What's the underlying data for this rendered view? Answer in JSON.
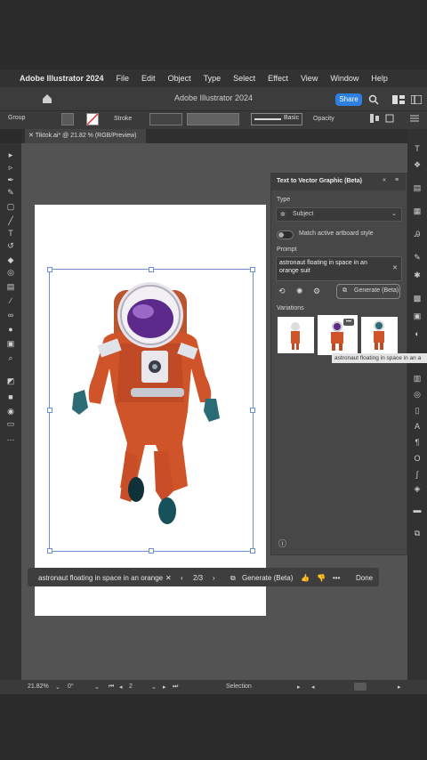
{
  "menubar": {
    "app_name": "Adobe Illustrator 2024",
    "items": [
      "File",
      "Edit",
      "Object",
      "Type",
      "Select",
      "Effect",
      "View",
      "Window",
      "Help"
    ]
  },
  "titlebar": {
    "title": "Adobe Illustrator 2024",
    "share_label": "Share"
  },
  "controlbar": {
    "selection_label": "Group",
    "stroke_label": "Stroke",
    "brush_label": "Basic",
    "opacity_label": "Opacity"
  },
  "document": {
    "tab_label": "Tiktok.ai* @ 21.82 % (RGB/Preview)"
  },
  "panel": {
    "title": "Text to Vector Graphic (Beta)",
    "type_label": "Type",
    "type_value": "Subject",
    "match_label": "Match active artboard style",
    "prompt_label": "Prompt",
    "prompt_value": "astronaut floating in space in an orange suit",
    "generate_label": "Generate (Beta)",
    "variations_label": "Variations",
    "tooltip": "astronaut floating in space in an a"
  },
  "context_bar": {
    "prompt_value": "astronaut floating in space in an orange",
    "page_indicator": "2/3",
    "generate_label": "Generate (Beta)",
    "more_label": "•••",
    "done_label": "Done"
  },
  "statusbar": {
    "zoom": "21.82%",
    "rotation": "0°",
    "artboard_number": "2",
    "tool_name": "Selection"
  },
  "colors": {
    "accent": "#2d7fe0",
    "suit_orange": "#d0542a",
    "visor_purple": "#5b2a8a"
  }
}
